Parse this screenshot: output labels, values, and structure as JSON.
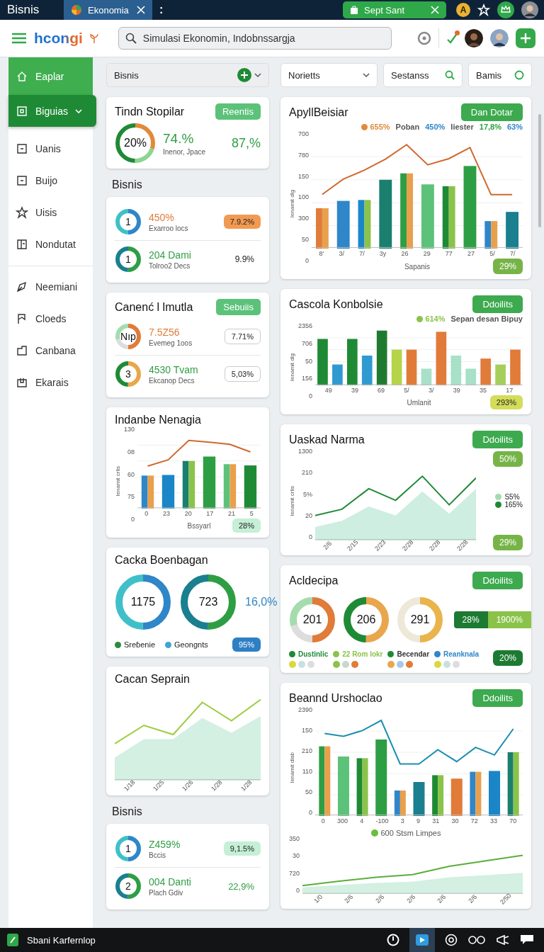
{
  "topbar": {
    "title": "Bisnis",
    "menu": ":",
    "tabs": [
      {
        "label": "Ekonomia",
        "selected": true
      },
      {
        "label": "Sept Sant",
        "selected": false
      }
    ],
    "badge_letter": "A"
  },
  "header": {
    "logo": "hcongi",
    "search": {
      "value": "Simulasi Ekonomin, Indobnssargja"
    }
  },
  "sidebar": {
    "groups": [
      {
        "items": [
          {
            "label": "Eaplar",
            "highlighted": true,
            "selected": false,
            "expandable": false
          },
          {
            "label": "Biguias",
            "highlighted": false,
            "selected": true,
            "expandable": true
          },
          {
            "label": "Uanis",
            "highlighted": false,
            "selected": false,
            "expandable": false
          },
          {
            "label": "Buijo",
            "highlighted": false,
            "selected": false,
            "expandable": false
          },
          {
            "label": "Uisis",
            "highlighted": false,
            "selected": false,
            "expandable": false
          },
          {
            "label": "Nondutat",
            "highlighted": false,
            "selected": false,
            "expandable": false
          }
        ]
      },
      {
        "items": [
          {
            "label": "Neemiani",
            "highlighted": false,
            "selected": false,
            "expandable": false
          },
          {
            "label": "Cloeds",
            "highlighted": false,
            "selected": false,
            "expandable": false
          },
          {
            "label": "Canbana",
            "highlighted": false,
            "selected": false,
            "expandable": false
          },
          {
            "label": "Ekarais",
            "highlighted": false,
            "selected": false,
            "expandable": false
          }
        ]
      }
    ]
  },
  "filters": [
    {
      "label": "Bisnis",
      "kind": "add"
    },
    {
      "label": "Norietts",
      "kind": "dropdown"
    },
    {
      "label": "Sestanss",
      "kind": "search"
    },
    {
      "label": "Bamis",
      "kind": "radio"
    }
  ],
  "left_column": [
    {
      "kind": "stat",
      "title": "Tindn Stopilar",
      "button": "Reentis",
      "ring": "20%",
      "value": "74.%",
      "caption": "Inenor, Jpace",
      "value2": "87,%"
    },
    {
      "kind": "heading",
      "title": "Bisnis"
    },
    {
      "kind": "list",
      "rows": [
        {
          "ring": "1",
          "value": "450%",
          "color": "#e07b39",
          "caption": "Exarroo locs",
          "badge": {
            "label": "7.9.2%",
            "kind": "orange"
          }
        },
        {
          "ring": "1",
          "value": "204 Dami",
          "color": "#2e9e44",
          "caption": "Tolroo2 Decs",
          "badge": {
            "label": "9.9%",
            "kind": "plain"
          }
        }
      ]
    },
    {
      "kind": "list",
      "title": "Canenć l lmutla",
      "button": "Sebuiis",
      "rows": [
        {
          "ring": "Nıp",
          "value": "7.5Z56",
          "color": "#e07b39",
          "caption": "Evemeg 1oos",
          "badge": {
            "label": "7.71%",
            "kind": "outline"
          }
        },
        {
          "ring": "3",
          "value": "4530 Tvam",
          "color": "#2e9e44",
          "caption": "Ekcanop Decs",
          "badge": {
            "label": "5,03%",
            "kind": "outline"
          }
        }
      ]
    },
    {
      "kind": "chart",
      "title": "Indanbe Nenagia",
      "chart": {
        "kind": "combo",
        "ylabel": "Ienamit crlis",
        "yticks": [
          "130",
          "08",
          "60",
          "75",
          "0"
        ],
        "xticks": [
          "0",
          "23",
          "20",
          "17",
          "21",
          "5"
        ],
        "xlabel": "Bssyarl"
      },
      "badge": {
        "label": "28%",
        "kind": "mint"
      }
    },
    {
      "kind": "rings",
      "title": "Cacka Boenbagan",
      "rings": [
        "1175",
        "723"
      ],
      "value": "16,0%",
      "legend": [
        {
          "label": "Sreɓenie",
          "color": "#2e8b3e"
        },
        {
          "label": "Geongnts",
          "color": "#3aa6d8"
        }
      ],
      "badge": {
        "label": "95%",
        "kind": "blue"
      }
    },
    {
      "kind": "chart",
      "title": "Cacan Seprain",
      "chart": {
        "kind": "area",
        "xticks": [
          "1/18",
          "1/25",
          "1/26",
          "1/28",
          "1/28"
        ]
      }
    },
    {
      "kind": "heading",
      "title": "Bisnis"
    },
    {
      "kind": "list",
      "rows": [
        {
          "ring": "1",
          "value": "Z459%",
          "color": "#2e9e44",
          "caption": "Bccis",
          "badge": {
            "label": "9,1.5%",
            "kind": "mint"
          }
        },
        {
          "ring": "2",
          "value": "004 Danti",
          "color": "#2e9e44",
          "caption": "Plach Gdiv",
          "badge": {
            "label": "22,9%",
            "kind": "greentext"
          }
        }
      ]
    }
  ],
  "right_column": [
    {
      "kind": "chart",
      "title": "ApyllBeisiar",
      "button": "Dan Dotar",
      "legend": [
        {
          "label": "655%",
          "color": "#e08a3a",
          "marker": true
        },
        {
          "label": "Poban",
          "color": "#555555",
          "marker": false
        },
        {
          "label": "450%",
          "color": "#2f86c8",
          "marker": false
        },
        {
          "label": "Iiester",
          "color": "#555555",
          "marker": false
        },
        {
          "label": "17,8%",
          "color": "#2e9e44",
          "marker": false
        },
        {
          "label": "63%",
          "color": "#2f86c8",
          "marker": false
        }
      ],
      "chart": {
        "kind": "combo",
        "ylabel": "Ienamit dlg",
        "yticks": [
          "700",
          "780",
          "150",
          "100",
          "300",
          "50",
          "0"
        ],
        "xticks": [
          "8'",
          "3/",
          "7/",
          "3y",
          "26",
          "29",
          "77",
          "27",
          "5/",
          "7/"
        ],
        "xlabel": "Sapanis"
      },
      "badge": {
        "label": "29%",
        "kind": "olive"
      }
    },
    {
      "kind": "chart",
      "title": "Cascola Konbolsie",
      "button": "Ddoilits",
      "legend": [
        {
          "label": "614%",
          "color": "#8bc34a",
          "marker": true
        },
        {
          "label": "Sepan desan Bipuy",
          "color": "#555555",
          "marker": false
        }
      ],
      "chart": {
        "kind": "bars",
        "ylabel": "Ienamit dlg",
        "yticks": [
          "2356",
          "706",
          "50",
          "156",
          "0"
        ],
        "xticks": [
          "49",
          "39",
          "69",
          "5/",
          "3/",
          "39",
          "35",
          "17"
        ],
        "xlabel": "Umlanit"
      },
      "badge": {
        "label": "293%",
        "kind": "yellow"
      }
    },
    {
      "kind": "lines",
      "title": "Uaskad Narma",
      "button": "Ddoilits",
      "top_badge": {
        "label": "50%",
        "kind": "olive"
      },
      "legend": [
        {
          "label": "S5%",
          "color": "#a5dcae"
        },
        {
          "label": "165%",
          "color": "#1f8a35"
        }
      ],
      "chart": {
        "kind": "lines",
        "ylabel": "Ienamit crlis",
        "yticks": [
          "1300",
          "210",
          "5%",
          "20",
          "0"
        ],
        "xticks": [
          "2/6",
          "2/15",
          "2/23",
          "2/28",
          "2/28",
          "2/28"
        ]
      },
      "badge": {
        "label": "29%",
        "kind": "olive"
      }
    },
    {
      "kind": "rings3",
      "title": "Acldecipa",
      "button": "Ddoilits",
      "rings": [
        "201",
        "206",
        "291"
      ],
      "split": [
        {
          "label": "28%",
          "kind": "dark"
        },
        {
          "label": "1900%",
          "kind": "lime"
        }
      ],
      "legend": [
        {
          "label": "Dustinlic",
          "color": "#1f8a35"
        },
        {
          "label": "22 Rom lokr",
          "color": "#8bc34a"
        },
        {
          "label": "Becendar",
          "color": "#1f8a35"
        },
        {
          "label": "Reanknala",
          "color": "#2f86c8"
        }
      ],
      "badge": {
        "label": "20%",
        "kind": "dark"
      }
    },
    {
      "kind": "double",
      "title": "Beannd Urshoclao",
      "button": "Ddoilits",
      "chart": {
        "kind": "combo2",
        "ylabel": "Ienamit dlab",
        "yticks": [
          "2390",
          "150",
          "210",
          "110",
          "50",
          "0"
        ],
        "xticks": [
          "0",
          "300",
          "4",
          "-100",
          "3",
          "9",
          "31",
          "30",
          "72",
          "33",
          "70"
        ]
      },
      "caption": "600 Stsm Limpes",
      "chart2": {
        "kind": "area2",
        "yticks": [
          "350",
          "30",
          "720",
          "0"
        ],
        "xticks": [
          "1/0",
          "2/6",
          "2/6",
          "2/6",
          "2/6",
          "2/6",
          "2/50"
        ]
      }
    }
  ],
  "taskbar": {
    "title": "Sbani Karfernlop"
  }
}
